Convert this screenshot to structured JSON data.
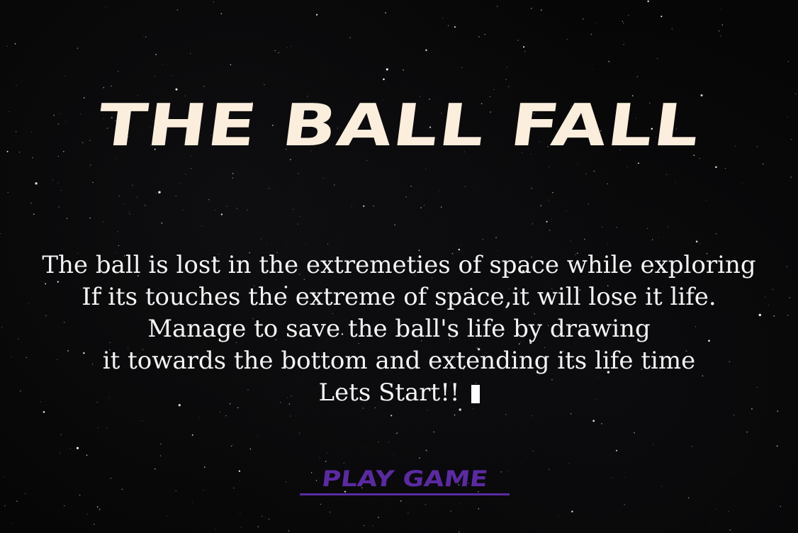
{
  "game": {
    "title": "THE BALL FALL",
    "story_lines": [
      "The ball is lost in the extremeties of space while exploring",
      "If its touches the extreme of space,it will lose it life.",
      "Manage to save the ball's life by drawing",
      "it towards the bottom and extending its life time",
      "Lets Start!!"
    ],
    "play_button_label": "PLAY GAME"
  },
  "colors": {
    "background": "#060606",
    "title": "#fbeedd",
    "story_text": "#f4f4f4",
    "play_button": "#5b2aa2"
  },
  "icons": {
    "text_cursor": "text-cursor-icon"
  }
}
